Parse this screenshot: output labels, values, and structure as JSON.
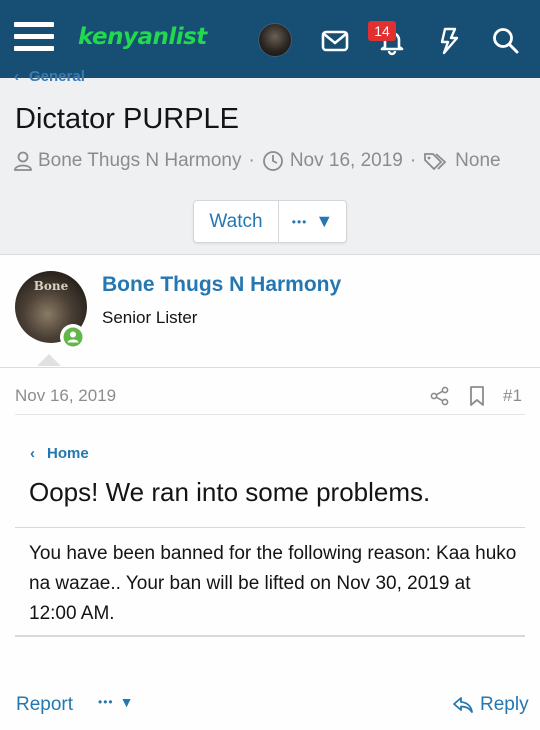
{
  "header": {
    "logo_text": "kenyanlist",
    "notification_count": "14",
    "colors": {
      "bar": "#174e73",
      "logo": "#22d84f",
      "badge": "#e03030"
    },
    "icons": [
      "menu-icon",
      "avatar",
      "mail-icon",
      "bell-icon",
      "lightning-icon",
      "search-icon"
    ]
  },
  "breadcrumb": {
    "label": "General"
  },
  "thread": {
    "title": "Dictator PURPLE",
    "author": "Bone Thugs N Harmony",
    "date": "Nov 16, 2019",
    "tags": "None",
    "sep": "·",
    "watch_label": "Watch",
    "more_label": "•••"
  },
  "post": {
    "avatar_text": "Bone",
    "username": "Bone Thugs N Harmony",
    "user_title": "Senior Lister",
    "date": "Nov 16, 2019",
    "number": "#1",
    "error": {
      "home_label": "Home",
      "heading": "Oops! We ran into some problems.",
      "message": "You have been banned for the following reason: Kaa huko na wazae.. Your ban will be lifted on Nov 30, 2019 at 12:00 AM."
    },
    "report_label": "Report",
    "more_label": "•••",
    "reply_label": "Reply"
  },
  "colors": {
    "link": "#2577b1",
    "muted": "#8c8c8c",
    "online": "#63b64a"
  }
}
